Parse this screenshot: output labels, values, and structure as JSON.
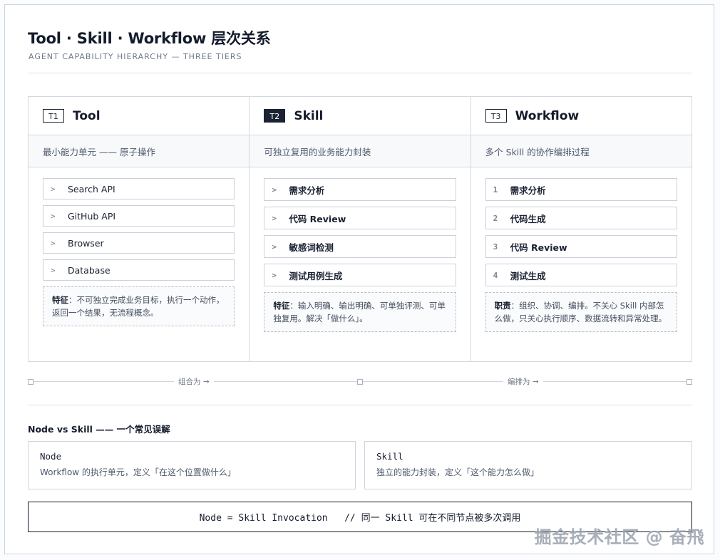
{
  "title": "Tool · Skill · Workflow 层次关系",
  "subtitle": "AGENT CAPABILITY HIERARCHY — THREE TIERS",
  "columns": [
    {
      "tier": "T1",
      "name": "Tool",
      "desc": "最小能力单元 —— 原子操作",
      "items": [
        {
          "mark": ">",
          "label": "Search API"
        },
        {
          "mark": ">",
          "label": "GitHub API"
        },
        {
          "mark": ">",
          "label": "Browser"
        },
        {
          "mark": ">",
          "label": "Database"
        }
      ],
      "note_label": "特征",
      "note_text": "：不可独立完成业务目标，执行一个动作，返回一个结果，无流程概念。"
    },
    {
      "tier": "T2",
      "name": "Skill",
      "desc": "可独立复用的业务能力封装",
      "items": [
        {
          "mark": ">",
          "label": "需求分析"
        },
        {
          "mark": ">",
          "label": "代码 Review"
        },
        {
          "mark": ">",
          "label": "敏感词检测"
        },
        {
          "mark": ">",
          "label": "测试用例生成"
        }
      ],
      "note_label": "特征",
      "note_text": "：输入明确、输出明确、可单独评测、可单独复用。解决「做什么」。"
    },
    {
      "tier": "T3",
      "name": "Workflow",
      "desc": "多个 Skill 的协作编排过程",
      "items": [
        {
          "mark": "1",
          "label": "需求分析"
        },
        {
          "mark": "2",
          "label": "代码生成"
        },
        {
          "mark": "3",
          "label": "代码 Review"
        },
        {
          "mark": "4",
          "label": "测试生成"
        }
      ],
      "note_label": "职责",
      "note_text": "：组织、协调、编排。不关心 Skill 内部怎么做，只关心执行顺序、数据流转和异常处理。"
    }
  ],
  "connectors": {
    "left": "组合为 →",
    "right": "编排为 →"
  },
  "section_title": "Node vs Skill —— 一个常见误解",
  "compare": [
    {
      "title": "Node",
      "desc": "Workflow 的执行单元，定义「在这个位置做什么」"
    },
    {
      "title": "Skill",
      "desc": "独立的能力封装，定义「这个能力怎么做」"
    }
  ],
  "formula": "Node = Skill Invocation   // 同一 Skill 可在不同节点被多次调用",
  "watermark": "掘金技术社区 @ 奋飛"
}
